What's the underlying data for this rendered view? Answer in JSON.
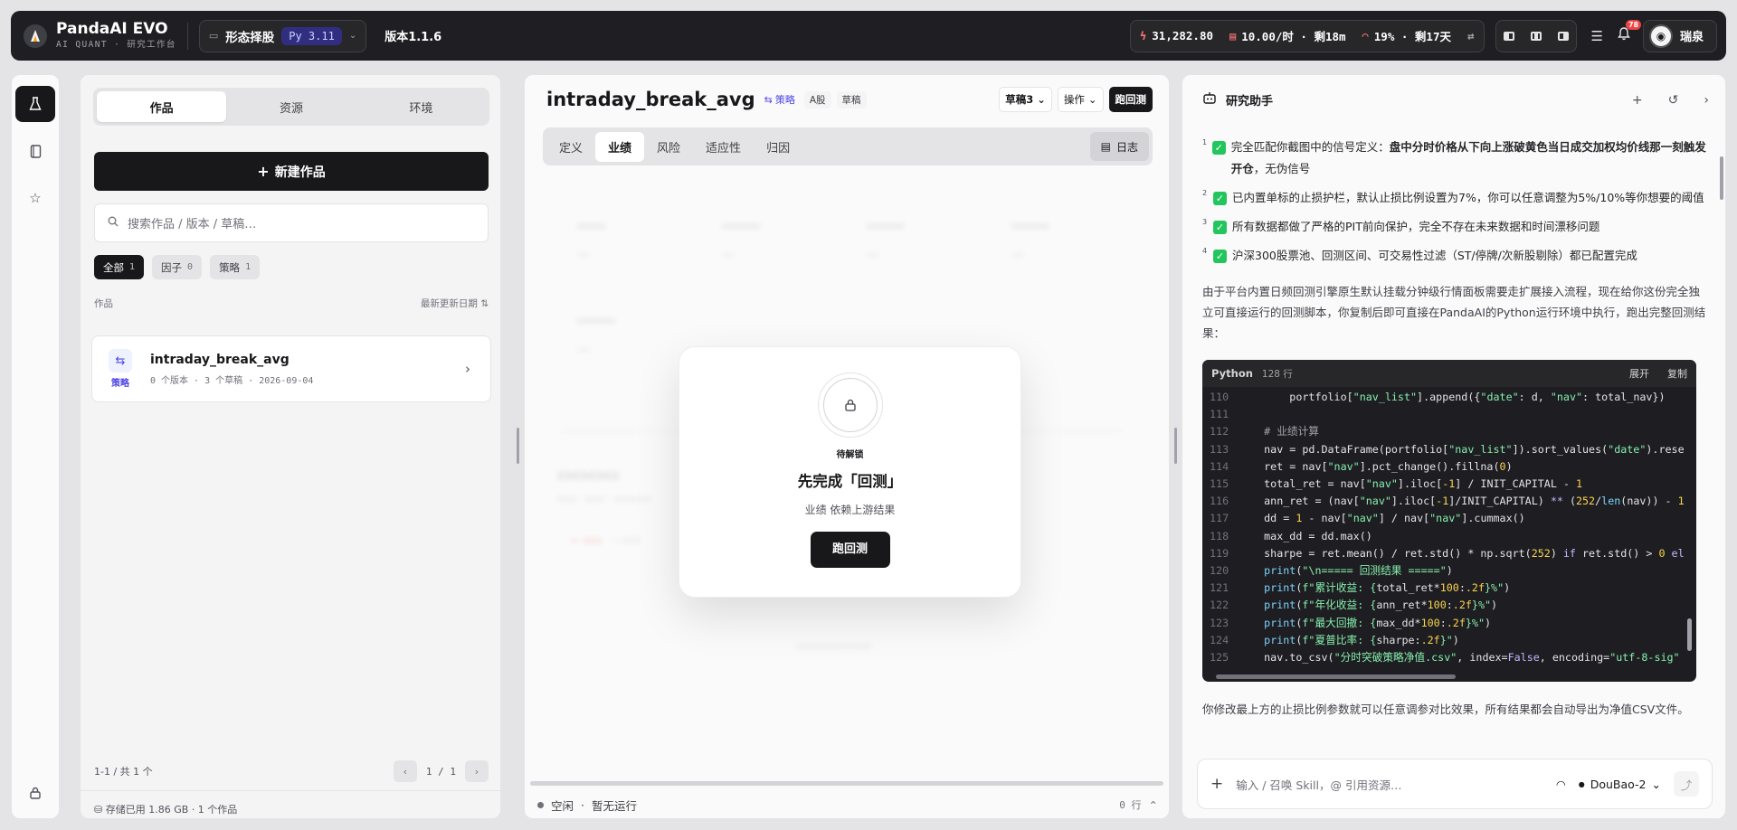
{
  "topbar": {
    "app_title": "PandaAI EVO",
    "app_subtitle": "AI QUANT · 研究工作台",
    "project_name": "形态择股",
    "python_badge": "Py 3.11",
    "version": "版本1.1.6",
    "balance": "31,282.80",
    "rate": "10.00/时 · 剩18m",
    "quota": "19% · 剩17天",
    "notification_count": "78",
    "user_name": "瑞泉"
  },
  "left": {
    "tabs": [
      "作品",
      "资源",
      "环境"
    ],
    "new_button": "新建作品",
    "search_placeholder": "搜索作品 / 版本 / 草稿…",
    "chips": [
      {
        "label": "全部",
        "count": "1"
      },
      {
        "label": "因子",
        "count": "0"
      },
      {
        "label": "策略",
        "count": "1"
      }
    ],
    "list_header_left": "作品",
    "list_header_right": "最新更新日期",
    "card": {
      "title": "intraday_break_avg",
      "type": "策略",
      "meta": "0 个版本 · 3 个草稿 · 2026-09-04"
    },
    "pager_summary": "1-1 / 共 1 个",
    "page_current": "1",
    "page_total": "1",
    "storage": "存储已用 1.86 GB · 1 个作品"
  },
  "center": {
    "title": "intraday_break_avg",
    "type_badge": "策略",
    "market_badge": "A股",
    "draft_badge": "草稿",
    "draft_select": "草稿3",
    "ops_select": "操作",
    "run_button": "跑回测",
    "tabs": [
      "定义",
      "业绩",
      "风险",
      "适应性",
      "归因"
    ],
    "active_tab": "业绩",
    "log_button": "日志",
    "modal": {
      "kicker": "待解锁",
      "title": "先完成「回测」",
      "subtitle": "业绩 依赖上游结果",
      "button": "跑回测"
    },
    "status": "空闲",
    "status_detail": "暂无运行",
    "rows": "0 行"
  },
  "assistant": {
    "title": "研究助手",
    "items": [
      {
        "num": "1",
        "text_plain": "完全匹配你截图中的信号定义：",
        "text_bold": "盘中分时价格从下向上涨破黄色当日成交加权均价线那一刻触发开仓",
        "text_after": "，无伪信号"
      },
      {
        "num": "2",
        "text_plain": "已内置单标的止损护栏，默认止损比例设置为7%，你可以任意调整为5%/10%等你想要的阈值",
        "text_bold": "",
        "text_after": ""
      },
      {
        "num": "3",
        "text_plain": "所有数据都做了严格的PIT前向保护，完全不存在未来数据和时间漂移问题",
        "text_bold": "",
        "text_after": ""
      },
      {
        "num": "4",
        "text_plain": "沪深300股票池、回测区间、可交易性过滤（ST/停牌/次新股剔除）都已配置完成",
        "text_bold": "",
        "text_after": ""
      }
    ],
    "intro": "由于平台内置日频回测引擎原生默认挂载分钟级行情面板需要走扩展接入流程，现在给你这份完全独立可直接运行的回测脚本，你复制后即可直接在PandaAI的Python运行环境中执行，跑出完整回测结果：",
    "code_lang": "Python",
    "code_lines_label": "128 行",
    "code_expand": "展开",
    "code_copy": "复制",
    "outro": "你修改最上方的止损比例参数就可以任意调参对比效果，所有结果都会自动导出为净值CSV文件。",
    "composer_placeholder": "输入 / 召唤 Skill，@ 引用资源…",
    "model": "DouBao-2"
  }
}
